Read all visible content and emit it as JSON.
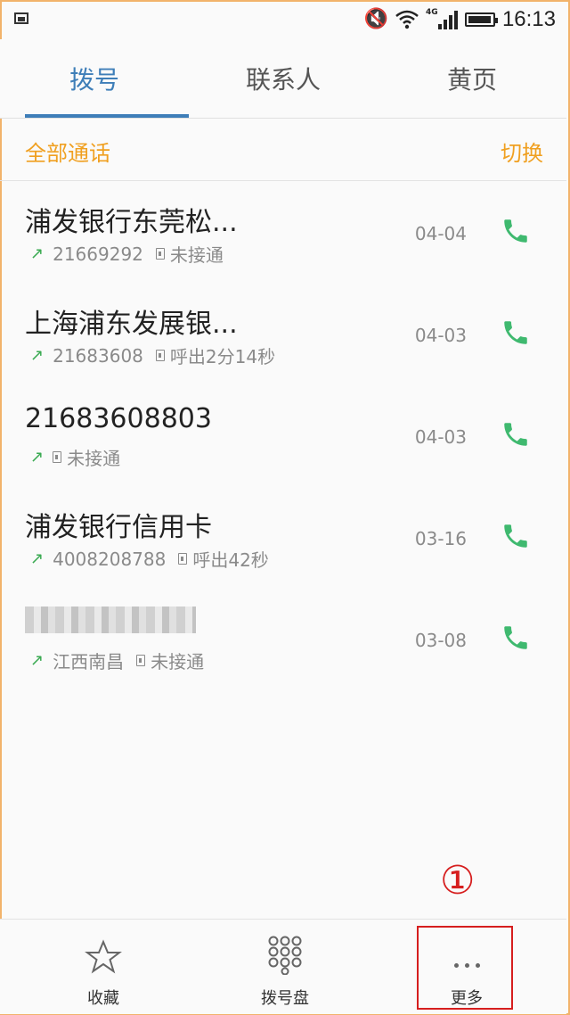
{
  "status_bar": {
    "time": "16:13",
    "network": "4G",
    "mute_glyph": "🔇"
  },
  "tabs": [
    {
      "label": "拨号",
      "active": true
    },
    {
      "label": "联系人",
      "active": false
    },
    {
      "label": "黄页",
      "active": false
    }
  ],
  "filter": {
    "all_calls": "全部通话",
    "switch": "切换"
  },
  "calls": [
    {
      "name": "浦发银行东莞松...",
      "number": "21669292",
      "status": "未接通",
      "date": "04-04"
    },
    {
      "name": "上海浦东发展银...",
      "number": "21683608",
      "status": "呼出2分14秒",
      "date": "04-03"
    },
    {
      "name": "21683608803",
      "number": "",
      "status": "未接通",
      "date": "04-03"
    },
    {
      "name": "浦发银行信用卡",
      "number": "4008208788",
      "status": "呼出42秒",
      "date": "03-16"
    },
    {
      "name": "",
      "number": "江西南昌",
      "status": "未接通",
      "date": "03-08",
      "name_blurred": true
    }
  ],
  "annotation": {
    "marker": "①"
  },
  "bottom_nav": {
    "favorites": "收藏",
    "dialpad": "拨号盘",
    "more": "更多"
  },
  "colors": {
    "accent_blue": "#3e7eb8",
    "accent_orange": "#f0a021",
    "call_green": "#3fb96f",
    "outgoing_green": "#3aaa52",
    "annotation_red": "#d61e1e"
  },
  "icons": {
    "call": "phone-icon",
    "outgoing": "outgoing-arrow-icon",
    "sim": "sim-card-icon",
    "favorites": "star-icon",
    "dialpad": "dialpad-icon",
    "more": "more-dots-icon"
  }
}
